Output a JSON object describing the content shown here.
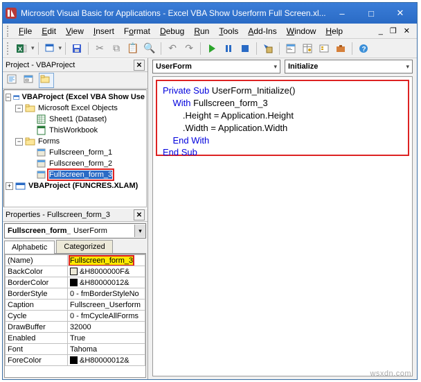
{
  "window": {
    "title": "Microsoft Visual Basic for Applications - Excel VBA Show Userform Full Screen.xl..."
  },
  "menu": {
    "file": "File",
    "edit": "Edit",
    "view": "View",
    "insert": "Insert",
    "format": "Format",
    "debug": "Debug",
    "run": "Run",
    "tools": "Tools",
    "addins": "Add-Ins",
    "window": "Window",
    "help": "Help"
  },
  "projectPanel": {
    "title": "Project - VBAProject",
    "vbaproj": "VBAProject (Excel VBA Show Use",
    "excelObjs": "Microsoft Excel Objects",
    "sheet1": "Sheet1 (Dataset)",
    "thiswb": "ThisWorkbook",
    "forms": "Forms",
    "form1": "Fullscreen_form_1",
    "form2": "Fullscreen_form_2",
    "form3": "Fullscreen_form_3",
    "funcres": "VBAProject (FUNCRES.XLAM)"
  },
  "propsPanel": {
    "title": "Properties - Fullscreen_form_3",
    "objName": "Fullscreen_form_",
    "objType": "UserForm",
    "tabAlpha": "Alphabetic",
    "tabCat": "Categorized",
    "rows": {
      "name_k": "(Name)",
      "name_v": "Fullscreen_form_3",
      "backcolor_k": "BackColor",
      "backcolor_v": "&H8000000F&",
      "bordercolor_k": "BorderColor",
      "bordercolor_v": "&H80000012&",
      "borderstyle_k": "BorderStyle",
      "borderstyle_v": "0 - fmBorderStyleNo",
      "caption_k": "Caption",
      "caption_v": "Fullscreen_Userform",
      "cycle_k": "Cycle",
      "cycle_v": "0 - fmCycleAllForms",
      "drawbuffer_k": "DrawBuffer",
      "drawbuffer_v": "32000",
      "enabled_k": "Enabled",
      "enabled_v": "True",
      "font_k": "Font",
      "font_v": "Tahoma",
      "forecolor_k": "ForeColor",
      "forecolor_v": "&H80000012&"
    }
  },
  "codePane": {
    "objectCombo": "UserForm",
    "procCombo": "Initialize",
    "code": {
      "l1a": "Private Sub",
      "l1b": " UserForm_Initialize()",
      "l2a": "    With",
      "l2b": " Fullscreen_form_3",
      "l3": "        .Height = Application.Height",
      "l4": "        .Width = Application.Width",
      "l5": "    End With",
      "l6": "End Sub"
    }
  },
  "watermark": "wsxdn.com"
}
